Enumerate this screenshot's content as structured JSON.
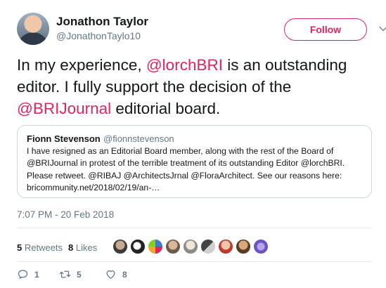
{
  "author": {
    "name": "Jonathon Taylor",
    "handle": "@JonathonTaylo10"
  },
  "follow_label": "Follow",
  "tweet": {
    "t1": "In my experience, ",
    "m1": "@lorchBRI",
    "t2": " is an outstanding editor. I fully support the decision of the ",
    "m2": "@BRIJournal",
    "t3": " editorial board."
  },
  "quote": {
    "name": "Fionn Stevenson",
    "handle": "@fionnstevenson",
    "lines": [
      "I have resigned as an Editorial Board member, along with the rest of the Board of",
      "@BRIJournal in protest of the terrible treatment of its outstanding Editor @lorchBRI.",
      "Please retweet.  @RIBAJ @ArchitectsJrnal @FloraArchitect. See our reasons here:",
      "bricommunity.net/2018/02/19/an-…"
    ]
  },
  "timestamp": "7:07 PM - 20 Feb 2018",
  "stats": {
    "retweets_count": "5",
    "retweets_label": " Retweets",
    "likes_count": "8",
    "likes_label": " Likes"
  },
  "actions": {
    "reply_count": "1",
    "retweet_count": "5",
    "like_count": "8"
  },
  "colors": {
    "accent": "#e0245e",
    "muted": "#657786",
    "text": "#14171a",
    "border": "#ccd6dd"
  },
  "icons": [
    "chevron-down-icon",
    "reply-icon",
    "retweet-icon",
    "heart-icon"
  ]
}
